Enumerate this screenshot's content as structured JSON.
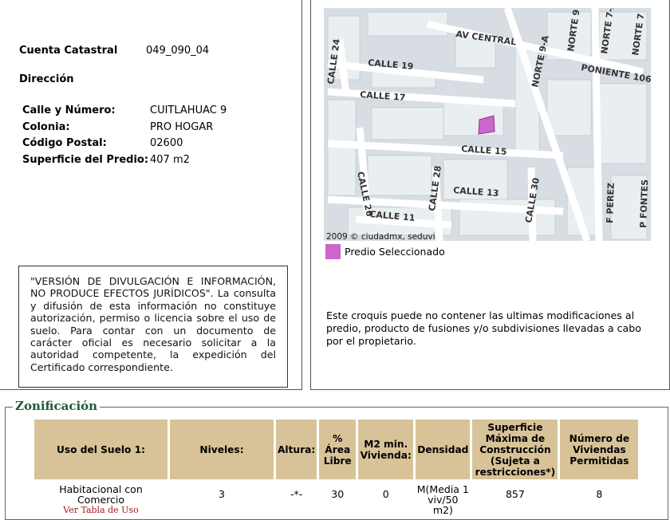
{
  "info": {
    "cuenta_label": "Cuenta Catastral",
    "cuenta_value": "049_090_04",
    "direccion_title": "Dirección",
    "address": [
      {
        "label": "Calle y Número:",
        "value": "CUITLAHUAC 9"
      },
      {
        "label": "Colonia:",
        "value": "PRO HOGAR"
      },
      {
        "label": "Código Postal:",
        "value": "02600"
      },
      {
        "label": "Superficie del Predio:",
        "value": "407 m2"
      }
    ],
    "disclaimer": "\"VERSIÓN DE DIVULGACIÓN E INFORMACIÓN, NO PRODUCE EFECTOS JURÍDICOS\". La consulta y difusión de esta información no constituye autorización, permiso o licencia sobre el uso de suelo. Para contar con un documento de carácter oficial es necesario solicitar a la autoridad competente, la expedición del Certificado correspondiente."
  },
  "map": {
    "streets": [
      "AV CENTRAL",
      "CALLE 19",
      "CALLE 24",
      "CALLE 17",
      "CALLE 15",
      "CALLE 26",
      "CALLE 28",
      "CALLE 13",
      "CALLE 11",
      "CALLE 30",
      "NORTE 9",
      "NORTE 7-A",
      "NORTE 7",
      "NORTE 9-A",
      "PONIENTE 106",
      "F PEREZ",
      "P FONTES"
    ],
    "copyright": "2009 © ciudadmx, seduvi",
    "legend_label": "Predio Seleccionado",
    "selected_color": "#cc66cc",
    "note": "Este croquis puede no contener las ultimas modificaciones al predio, producto de fusiones y/o subdivisiones llevadas a cabo por el propietario."
  },
  "zonificacion": {
    "title": "Zonificación",
    "headers": [
      "Uso del Suelo 1:",
      "Niveles:",
      "Altura:",
      "% Área Libre",
      "M2 min. Vivienda:",
      "Densidad",
      "Superficie Máxima de Construcción (Sujeta a restricciones*)",
      "Número de Viviendas Permitidas"
    ],
    "row": {
      "uso": "Habitacional con Comercio",
      "uso_link": "Ver Tabla de Uso",
      "niveles": "3",
      "altura": "-*-",
      "area_libre": "30",
      "m2_min": "0",
      "densidad": "M(Media 1 viv/50 m2)",
      "superficie": "857",
      "viviendas": "8"
    }
  }
}
